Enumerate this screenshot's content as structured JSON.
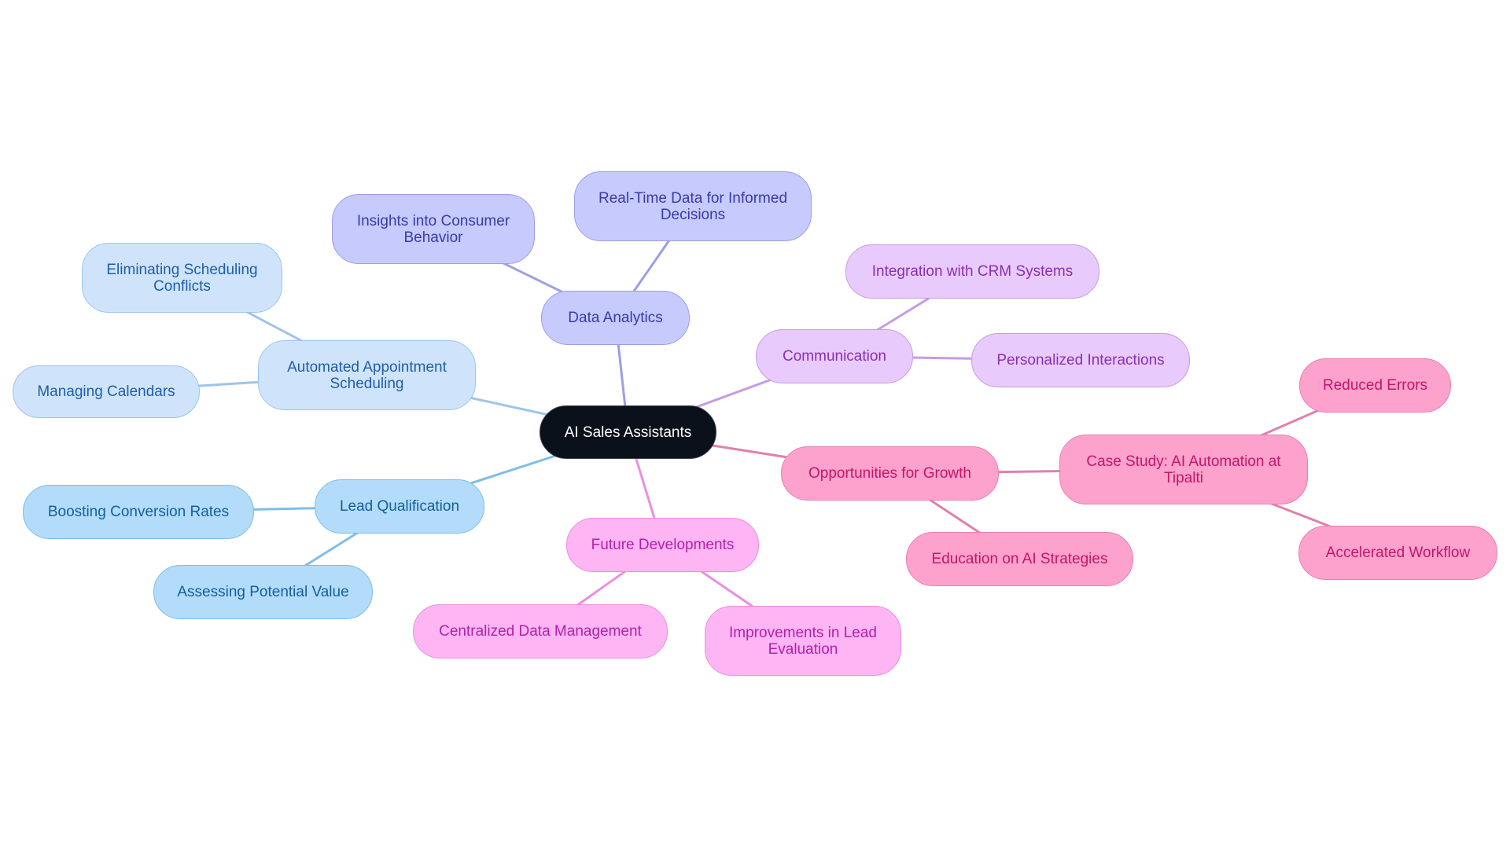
{
  "title": "AI Sales Assistants mind map",
  "colors": {
    "root": "#0b111a",
    "automated_scheduling": "#9dc4ec",
    "lead_qualification": "#7fbde8",
    "data_analytics": "#9b9fe6",
    "communication": "#c79ae8",
    "future_developments": "#eb8ee0",
    "opportunities": "#e080ad"
  },
  "root": {
    "label": "AI Sales Assistants"
  },
  "branches": [
    {
      "id": "automated-appointment-scheduling",
      "label": "Automated Appointment Scheduling",
      "children": [
        {
          "id": "eliminating-scheduling-conflicts",
          "label": "Eliminating Scheduling Conflicts"
        },
        {
          "id": "managing-calendars",
          "label": "Managing Calendars"
        }
      ]
    },
    {
      "id": "lead-qualification",
      "label": "Lead Qualification",
      "children": [
        {
          "id": "boosting-conversion-rates",
          "label": "Boosting Conversion Rates"
        },
        {
          "id": "assessing-potential-value",
          "label": "Assessing Potential Value"
        }
      ]
    },
    {
      "id": "data-analytics",
      "label": "Data Analytics",
      "children": [
        {
          "id": "insights-consumer-behavior",
          "label": "Insights into Consumer Behavior"
        },
        {
          "id": "real-time-data",
          "label": "Real-Time Data for Informed Decisions"
        }
      ]
    },
    {
      "id": "communication",
      "label": "Communication",
      "children": [
        {
          "id": "integration-crm",
          "label": "Integration with CRM Systems"
        },
        {
          "id": "personalized-interactions",
          "label": "Personalized Interactions"
        }
      ]
    },
    {
      "id": "opportunities-for-growth",
      "label": "Opportunities for Growth",
      "children": [
        {
          "id": "case-study-tipalti",
          "label": "Case Study: AI Automation at Tipalti",
          "children": [
            {
              "id": "reduced-errors",
              "label": "Reduced Errors"
            },
            {
              "id": "accelerated-workflow",
              "label": "Accelerated Workflow"
            }
          ]
        },
        {
          "id": "education-ai-strategies",
          "label": "Education on AI Strategies"
        }
      ]
    },
    {
      "id": "future-developments",
      "label": "Future Developments",
      "children": [
        {
          "id": "centralized-data-management",
          "label": "Centralized Data Management"
        },
        {
          "id": "improvements-lead-evaluation",
          "label": "Improvements in Lead Evaluation"
        }
      ]
    }
  ]
}
